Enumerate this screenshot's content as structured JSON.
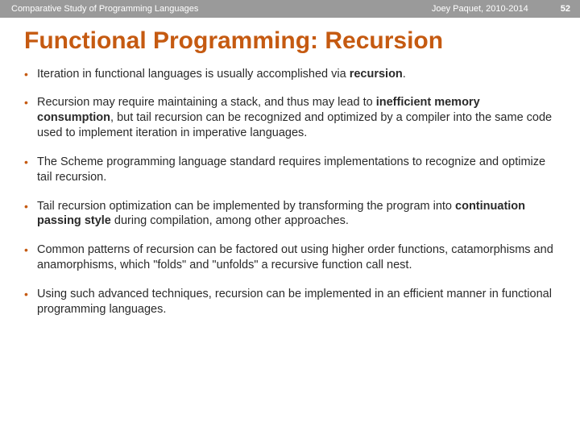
{
  "header": {
    "course": "Comparative Study of Programming Languages",
    "author": "Joey Paquet, 2010-2014",
    "page": "52"
  },
  "title": "Functional Programming: Recursion",
  "bullets": [
    {
      "pre": "Iteration in functional languages is usually accomplished via ",
      "bold1": "recursion",
      "mid": ".",
      "bold2": "",
      "post": ""
    },
    {
      "pre": "Recursion may require maintaining a stack, and thus may lead to ",
      "bold1": "inefficient memory consumption",
      "mid": ", but tail recursion can be recognized and optimized by a compiler into the same code used to implement iteration in imperative languages.",
      "bold2": "",
      "post": ""
    },
    {
      "pre": "The Scheme programming language standard requires implementations to recognize and optimize tail recursion.",
      "bold1": "",
      "mid": "",
      "bold2": "",
      "post": ""
    },
    {
      "pre": "Tail recursion optimization can be implemented by transforming the program into ",
      "bold1": "continuation passing style",
      "mid": " during compilation, among other approaches.",
      "bold2": "",
      "post": ""
    },
    {
      "pre": "Common patterns of recursion can be factored out using higher order functions, catamorphisms and anamorphisms, which \"folds\" and \"unfolds\" a recursive function call nest.",
      "bold1": "",
      "mid": "",
      "bold2": "",
      "post": ""
    },
    {
      "pre": "Using such advanced techniques, recursion can be implemented in an efficient manner in functional programming languages.",
      "bold1": "",
      "mid": "",
      "bold2": "",
      "post": ""
    }
  ]
}
